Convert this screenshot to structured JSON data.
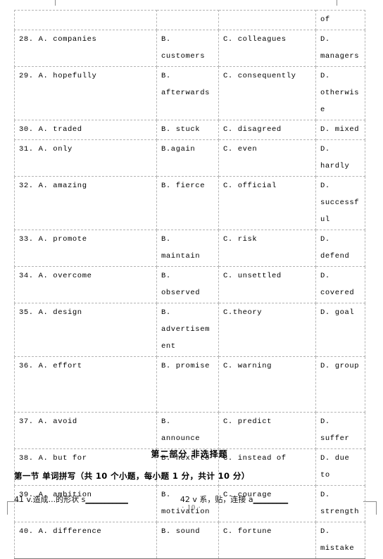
{
  "document": {
    "page_number": "· 10 ·"
  },
  "options_table": {
    "columns": [
      "A",
      "B",
      "C",
      "D"
    ],
    "rows": [
      {
        "a": "",
        "b": "",
        "c": "",
        "d": "of"
      },
      {
        "a": "28. A. companies",
        "b": "B. customers",
        "c": "C. colleagues",
        "d": "D. managers"
      },
      {
        "a": "29. A. hopefully",
        "b": "B. afterwards",
        "c": "C. consequently",
        "d": "D. otherwise"
      },
      {
        "a": "30. A. traded",
        "b": "B. stuck",
        "c": "C. disagreed",
        "d": "D. mixed"
      },
      {
        "a": "31. A. only",
        "b": "B.again",
        "c": "C. even",
        "d": "D. hardly"
      },
      {
        "a": "32. A. amazing",
        "b": "B. fierce",
        "c": "C. official",
        "d": "D. successful"
      },
      {
        "a": "33. A. promote",
        "b": "B. maintain",
        "c": "C. risk",
        "d": "D. defend"
      },
      {
        "a": "34. A. overcome",
        "b": "B. observed",
        "c": "C. unsettled",
        "d": "D. covered"
      },
      {
        "a": "35. A. design",
        "b": "B. advertisement",
        "c": "C.theory",
        "d": "D. goal"
      },
      {
        "a": "36. A. effort",
        "b": "B. promise",
        "c": "C. warning",
        "d": "D. group"
      },
      {
        "a": "37. A. avoid",
        "b": "B. announce",
        "c": "C. predict",
        "d": "D. suffer"
      },
      {
        "a": "38. A. but for",
        "b": "B. next to",
        "c": "C. instead of",
        "d": "D. due to"
      },
      {
        "a": "39. A. ambition",
        "b": "B. motivation",
        "c": "C. courage",
        "d": "D. strength"
      },
      {
        "a": "40. A. difference",
        "b": "B. sound",
        "c": "C. fortune",
        "d": "D. mistake"
      }
    ]
  },
  "part_two": {
    "title": "第二部分 非选择题",
    "section_one_title": "第一节 单词拼写（共 10 个小题，每小题 1 分，共计 10 分）",
    "spelling_items": [
      {
        "number": "41",
        "pos": "v.",
        "meaning": "造成...的形状",
        "hint": "s",
        "blank": "___________"
      },
      {
        "number": "42",
        "pos": "v",
        "meaning": "系，贴，连接",
        "hint": "a",
        "blank": "_________"
      }
    ]
  }
}
